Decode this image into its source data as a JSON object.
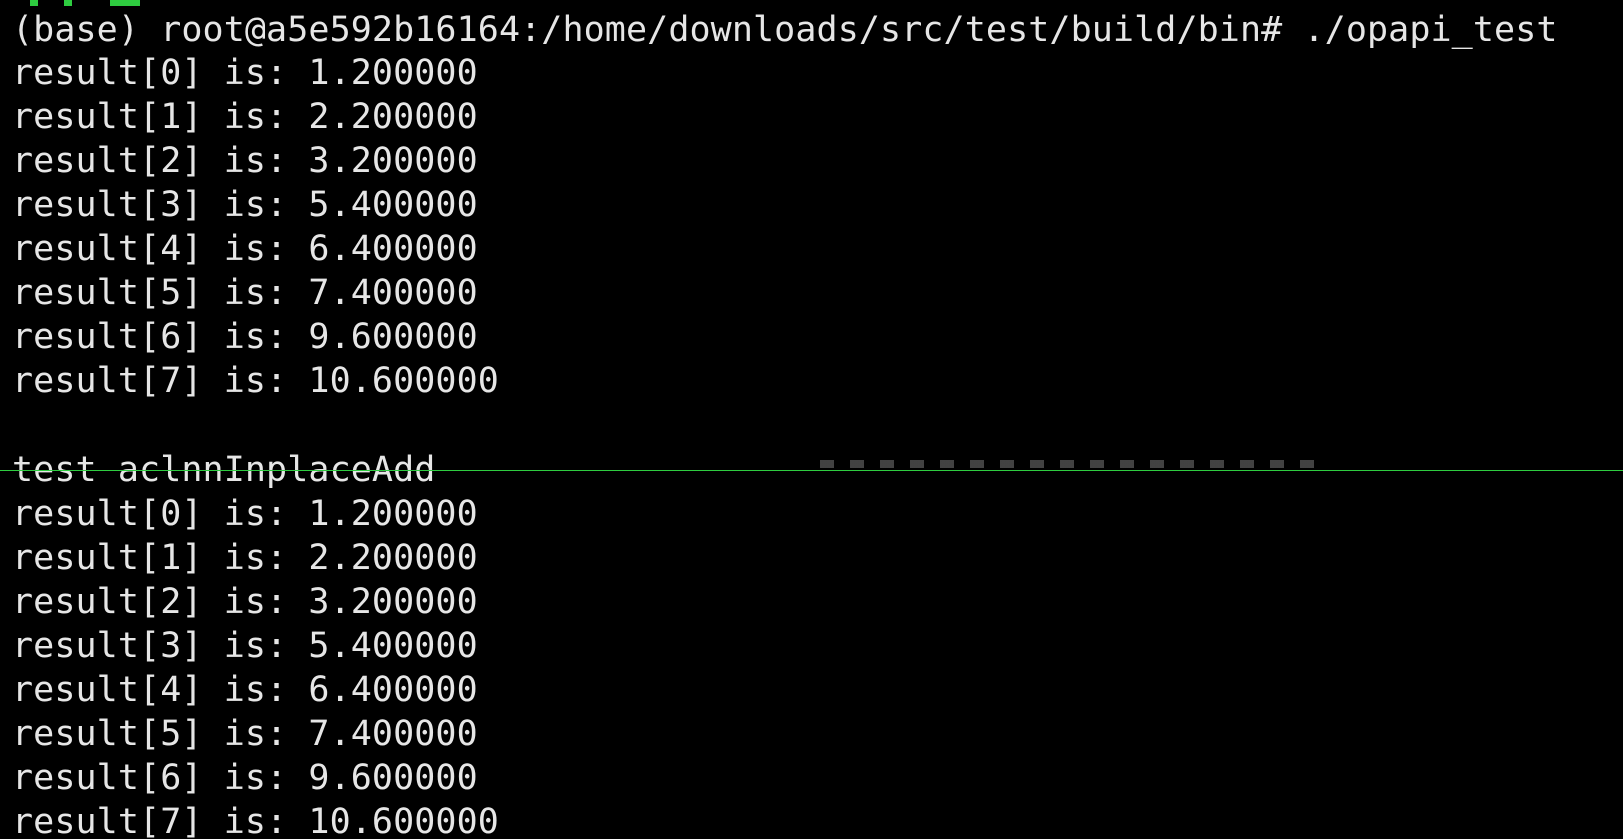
{
  "terminal": {
    "prompt": "(base) root@a5e592b16164:/home/downloads/src/test/build/bin# ./opapi_test",
    "first_run": [
      "result[0] is: 1.200000",
      "result[1] is: 2.200000",
      "result[2] is: 3.200000",
      "result[3] is: 5.400000",
      "result[4] is: 6.400000",
      "result[5] is: 7.400000",
      "result[6] is: 9.600000",
      "result[7] is: 10.600000"
    ],
    "section_label": "test aclnnInplaceAdd",
    "second_run": [
      "result[0] is: 1.200000",
      "result[1] is: 2.200000",
      "result[2] is: 3.200000",
      "result[3] is: 5.400000",
      "result[4] is: 6.400000",
      "result[5] is: 7.400000",
      "result[6] is: 9.600000",
      "result[7] is: 10.600000"
    ]
  },
  "colors": {
    "background": "#000000",
    "text": "#e6e6e6",
    "accent": "#2ecc40"
  }
}
